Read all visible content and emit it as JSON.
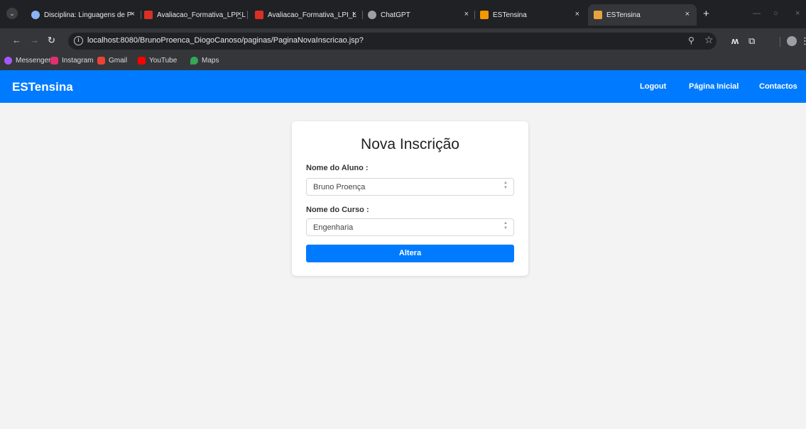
{
  "browser": {
    "tabs": [
      {
        "title": "Disciplina: Linguagens de P",
        "favicon_color": "#8ab4f8"
      },
      {
        "title": "Avaliacao_Formativa_LPI_L",
        "favicon_color": "#d93025"
      },
      {
        "title": "Avaliacao_Formativa_LPI_L",
        "favicon_color": "#d93025"
      },
      {
        "title": "ChatGPT",
        "favicon_color": "#9aa0a6"
      },
      {
        "title": "ESTensina",
        "favicon_color": "#f29900"
      },
      {
        "title": "ESTensina",
        "favicon_color": "#e8a33d",
        "active": true
      }
    ],
    "url": "localhost:8080/BrunoProenca_DiogoCanoso/paginas/PaginaNovaInscricao.jsp?",
    "bookmarks": [
      {
        "label": "Messenger",
        "color": "#a259ff"
      },
      {
        "label": "Instagram",
        "color": "#e1306c"
      },
      {
        "label": "Gmail",
        "color": "#ea4335"
      },
      {
        "label": "YouTube",
        "color": "#ff0000"
      },
      {
        "label": "Maps",
        "color": "#34a853"
      }
    ],
    "close_symbol": "×",
    "new_tab_symbol": "+"
  },
  "navbar": {
    "brand": "ESTensina",
    "links": [
      "Logout",
      "Página Inicial",
      "Contactos"
    ],
    "color": "#007bff"
  },
  "form": {
    "title": "Nova Inscrição",
    "student_label": "Nome do Aluno :",
    "student_value": "Bruno Proença",
    "course_label": "Nome do Curso :",
    "course_value": "Engenharia",
    "submit_label": "Altera"
  }
}
